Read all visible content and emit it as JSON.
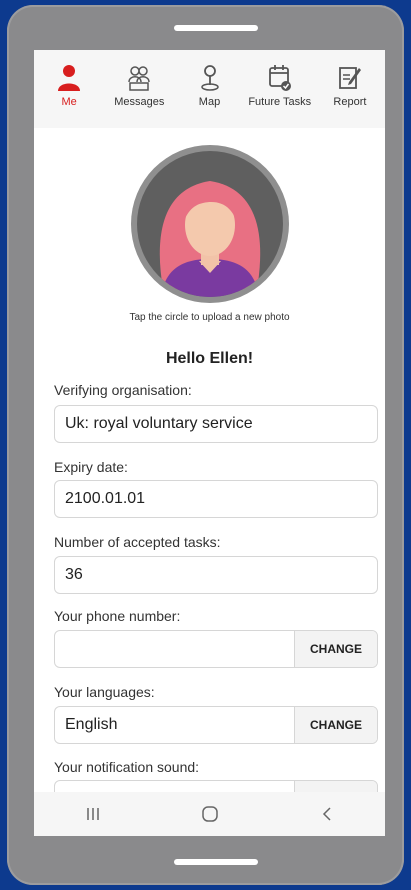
{
  "tabs": [
    {
      "label": "Me",
      "icon": "person-icon",
      "active": true
    },
    {
      "label": "Messages",
      "icon": "group-icon",
      "active": false
    },
    {
      "label": "Map",
      "icon": "map-pin-icon",
      "active": false
    },
    {
      "label": "Future Tasks",
      "icon": "calendar-check-icon",
      "active": false
    },
    {
      "label": "Report",
      "icon": "edit-report-icon",
      "active": false
    }
  ],
  "profile": {
    "upload_hint": "Tap the circle to upload a new photo",
    "greeting": "Hello Ellen!"
  },
  "fields": {
    "org_label": "Verifying organisation:",
    "org_value": "Uk: royal voluntary service",
    "expiry_label": "Expiry date:",
    "expiry_value": "2100.01.01",
    "tasks_label": "Number of accepted tasks:",
    "tasks_value": "36",
    "phone_label": "Your phone number:",
    "phone_value": "",
    "phone_change": "CHANGE",
    "lang_label": "Your languages:",
    "lang_value": "English",
    "lang_change": "CHANGE",
    "sound_label": "Your notification sound:"
  },
  "colors": {
    "accent": "#d81e1e",
    "background": "#0d3a8e",
    "frame": "#8a8a8c"
  },
  "navbar": [
    "recent-apps-icon",
    "home-icon",
    "back-icon"
  ]
}
